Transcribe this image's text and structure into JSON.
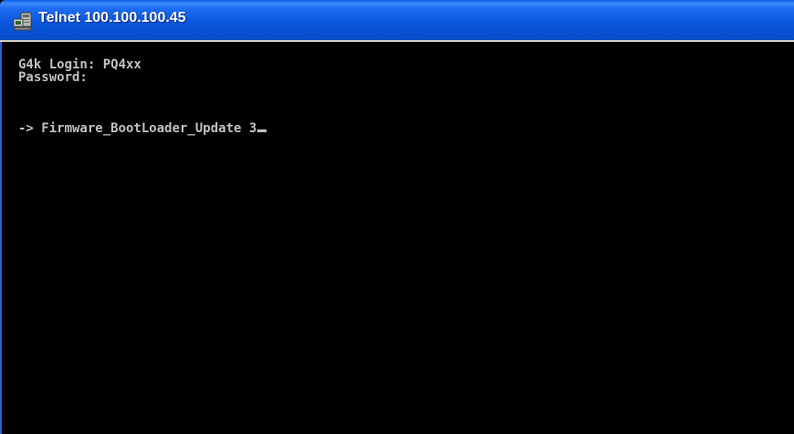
{
  "window": {
    "title": "Telnet 100.100.100.45",
    "icon": "telnet-terminal-icon"
  },
  "console": {
    "lines": [
      "G4k Login: PQ4xx",
      "Password:",
      "-> Firmware_BootLoader_Update 3"
    ]
  },
  "colors": {
    "titlebar": "#0a56dc",
    "console_background": "#000000",
    "console_text": "#c0c0c0"
  }
}
